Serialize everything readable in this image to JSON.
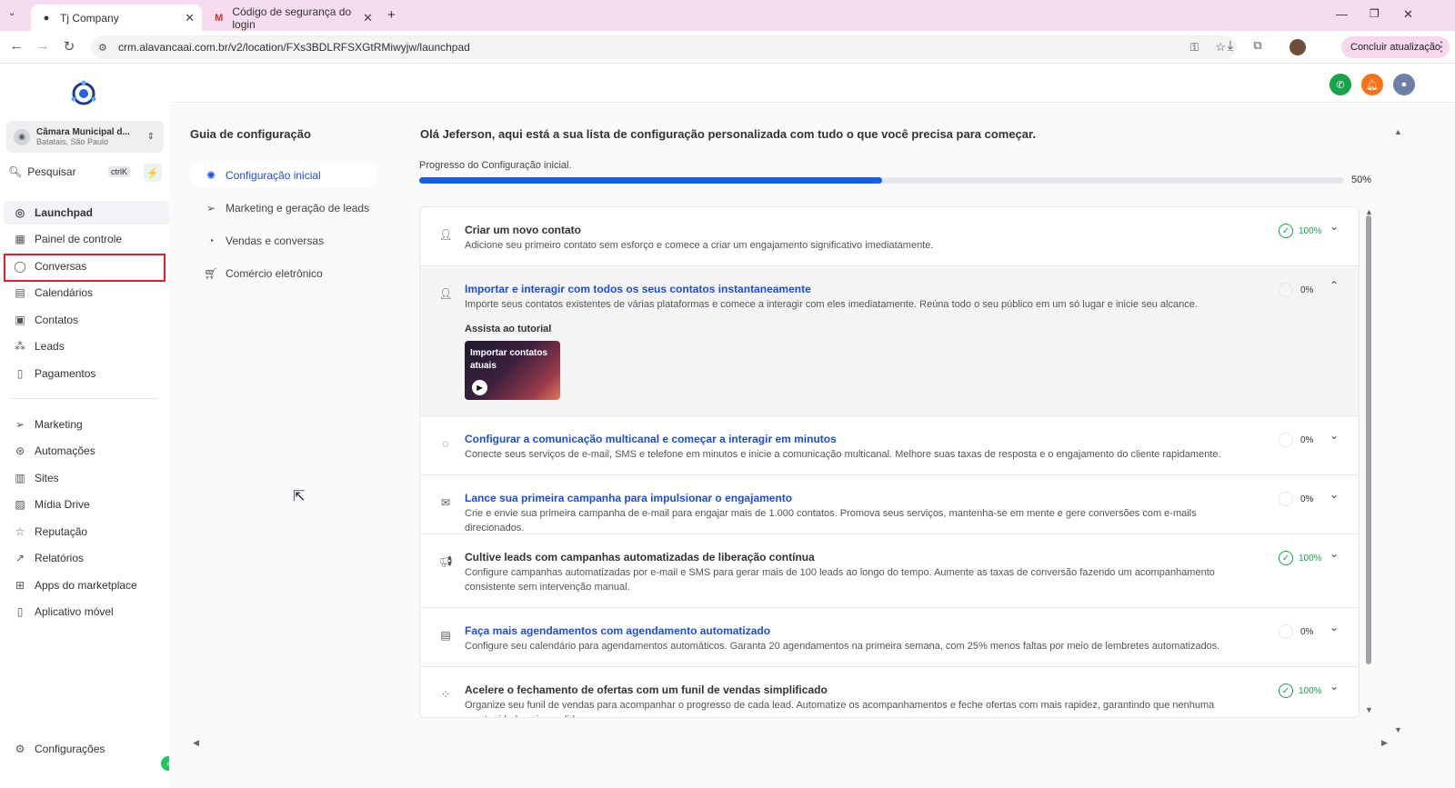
{
  "browser": {
    "tabs": [
      {
        "title": "Tj Company",
        "active": true
      },
      {
        "title": "Código de segurança do login",
        "active": false
      }
    ],
    "url": "crm.alavancaai.com.br/v2/location/FXs3BDLRFSXGtRMiwyjw/launchpad",
    "update_label": "Concluir atualização"
  },
  "sidebar": {
    "account_name": "Câmara Municipal d...",
    "account_location": "Batatais, São Paulo",
    "search_placeholder": "Pesquisar",
    "search_shortcut": "ctrlK",
    "items": [
      {
        "label": "Launchpad",
        "icon": "rocket-icon"
      },
      {
        "label": "Painel de controle",
        "icon": "dashboard-icon"
      },
      {
        "label": "Conversas",
        "icon": "chat-icon"
      },
      {
        "label": "Calendários",
        "icon": "calendar-icon"
      },
      {
        "label": "Contatos",
        "icon": "contacts-icon"
      },
      {
        "label": "Leads",
        "icon": "leads-icon"
      },
      {
        "label": "Pagamentos",
        "icon": "payments-icon"
      }
    ],
    "items2": [
      {
        "label": "Marketing",
        "icon": "send-icon"
      },
      {
        "label": "Automações",
        "icon": "automation-icon"
      },
      {
        "label": "Sites",
        "icon": "sites-icon"
      },
      {
        "label": "Mídia Drive",
        "icon": "image-icon"
      },
      {
        "label": "Reputação",
        "icon": "star-icon"
      },
      {
        "label": "Relatórios",
        "icon": "chart-icon"
      },
      {
        "label": "Apps do marketplace",
        "icon": "grid-icon"
      },
      {
        "label": "Aplicativo móvel",
        "icon": "phone-icon"
      }
    ],
    "settings_label": "Configurações"
  },
  "guide": {
    "title": "Guia de configuração",
    "items": [
      {
        "label": "Configuração inicial",
        "active": true
      },
      {
        "label": "Marketing e geração de leads",
        "active": false
      },
      {
        "label": "Vendas e conversas",
        "active": false
      },
      {
        "label": "Comércio eletrônico",
        "active": false
      }
    ]
  },
  "main": {
    "greeting": "Olá Jeferson, aqui está a sua lista de configuração personalizada com tudo o que você precisa para começar.",
    "progress_label": "Progresso do Configuração inicial.",
    "progress_value": 0.5,
    "progress_text": "50%",
    "tutorial_label": "Assista ao tutorial",
    "tutorial_thumb": "Importar contatos atuais",
    "tasks": [
      {
        "title": "Criar um novo contato",
        "desc": "Adicione seu primeiro contato sem esforço e comece a criar um engajamento significativo imediatamente.",
        "status": "100%",
        "done": true
      },
      {
        "title": "Importar e interagir com todos os seus contatos instantaneamente",
        "desc": "Importe seus contatos existentes de várias plataformas e comece a interagir com eles imediatamente. Reúna todo o seu público em um só lugar e inicie seu alcance.",
        "status": "0%",
        "done": false
      },
      {
        "title": "Configurar a comunicação multicanal e começar a interagir em minutos",
        "desc": "Conecte seus serviços de e-mail, SMS e telefone em minutos e inicie a comunicação multicanal. Melhore suas taxas de resposta e o engajamento do cliente rapidamente.",
        "status": "0%",
        "done": false
      },
      {
        "title": "Lance sua primeira campanha para impulsionar o engajamento",
        "desc": "Crie e envie sua primeira campanha de e-mail para engajar mais de 1.000 contatos. Promova seus serviços, mantenha-se em mente e gere conversões com e-mails direcionados.",
        "status": "0%",
        "done": false
      },
      {
        "title": "Cultive leads com campanhas automatizadas de liberação contínua",
        "desc": "Configure campanhas automatizadas por e-mail e SMS para gerar mais de 100 leads ao longo do tempo. Aumente as taxas de conversão fazendo um acompanhamento consistente sem intervenção manual.",
        "status": "100%",
        "done": true
      },
      {
        "title": "Faça mais agendamentos com agendamento automatizado",
        "desc": "Configure seu calendário para agendamentos automáticos. Garanta 20 agendamentos na primeira semana, com 25% menos faltas por meio de lembretes automatizados.",
        "status": "0%",
        "done": false
      },
      {
        "title": "Acelere o fechamento de ofertas com um funil de vendas simplificado",
        "desc": "Organize seu funil de vendas para acompanhar o progresso de cada lead. Automatize os acompanhamentos e feche ofertas com mais rapidez, garantindo que nenhuma oportunidade seja perdida.",
        "status": "100%",
        "done": true
      }
    ]
  },
  "colors": {
    "accent": "#155eef",
    "success": "#16a34a",
    "highlight": "#e11d2f"
  }
}
